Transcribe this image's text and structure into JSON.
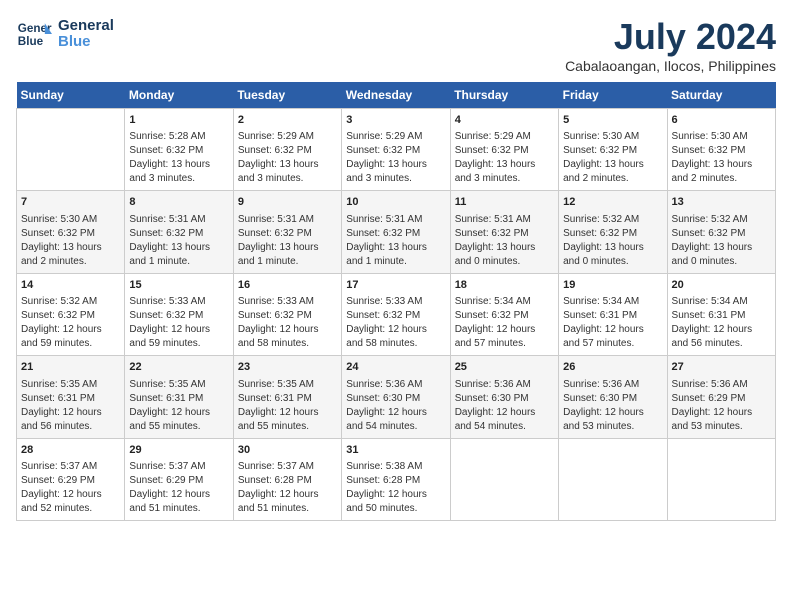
{
  "logo": {
    "line1": "General",
    "line2": "Blue"
  },
  "title": "July 2024",
  "subtitle": "Cabalaoangan, Ilocos, Philippines",
  "headers": [
    "Sunday",
    "Monday",
    "Tuesday",
    "Wednesday",
    "Thursday",
    "Friday",
    "Saturday"
  ],
  "weeks": [
    [
      {
        "day": "",
        "info": ""
      },
      {
        "day": "1",
        "info": "Sunrise: 5:28 AM\nSunset: 6:32 PM\nDaylight: 13 hours\nand 3 minutes."
      },
      {
        "day": "2",
        "info": "Sunrise: 5:29 AM\nSunset: 6:32 PM\nDaylight: 13 hours\nand 3 minutes."
      },
      {
        "day": "3",
        "info": "Sunrise: 5:29 AM\nSunset: 6:32 PM\nDaylight: 13 hours\nand 3 minutes."
      },
      {
        "day": "4",
        "info": "Sunrise: 5:29 AM\nSunset: 6:32 PM\nDaylight: 13 hours\nand 3 minutes."
      },
      {
        "day": "5",
        "info": "Sunrise: 5:30 AM\nSunset: 6:32 PM\nDaylight: 13 hours\nand 2 minutes."
      },
      {
        "day": "6",
        "info": "Sunrise: 5:30 AM\nSunset: 6:32 PM\nDaylight: 13 hours\nand 2 minutes."
      }
    ],
    [
      {
        "day": "7",
        "info": "Sunrise: 5:30 AM\nSunset: 6:32 PM\nDaylight: 13 hours\nand 2 minutes."
      },
      {
        "day": "8",
        "info": "Sunrise: 5:31 AM\nSunset: 6:32 PM\nDaylight: 13 hours\nand 1 minute."
      },
      {
        "day": "9",
        "info": "Sunrise: 5:31 AM\nSunset: 6:32 PM\nDaylight: 13 hours\nand 1 minute."
      },
      {
        "day": "10",
        "info": "Sunrise: 5:31 AM\nSunset: 6:32 PM\nDaylight: 13 hours\nand 1 minute."
      },
      {
        "day": "11",
        "info": "Sunrise: 5:31 AM\nSunset: 6:32 PM\nDaylight: 13 hours\nand 0 minutes."
      },
      {
        "day": "12",
        "info": "Sunrise: 5:32 AM\nSunset: 6:32 PM\nDaylight: 13 hours\nand 0 minutes."
      },
      {
        "day": "13",
        "info": "Sunrise: 5:32 AM\nSunset: 6:32 PM\nDaylight: 13 hours\nand 0 minutes."
      }
    ],
    [
      {
        "day": "14",
        "info": "Sunrise: 5:32 AM\nSunset: 6:32 PM\nDaylight: 12 hours\nand 59 minutes."
      },
      {
        "day": "15",
        "info": "Sunrise: 5:33 AM\nSunset: 6:32 PM\nDaylight: 12 hours\nand 59 minutes."
      },
      {
        "day": "16",
        "info": "Sunrise: 5:33 AM\nSunset: 6:32 PM\nDaylight: 12 hours\nand 58 minutes."
      },
      {
        "day": "17",
        "info": "Sunrise: 5:33 AM\nSunset: 6:32 PM\nDaylight: 12 hours\nand 58 minutes."
      },
      {
        "day": "18",
        "info": "Sunrise: 5:34 AM\nSunset: 6:32 PM\nDaylight: 12 hours\nand 57 minutes."
      },
      {
        "day": "19",
        "info": "Sunrise: 5:34 AM\nSunset: 6:31 PM\nDaylight: 12 hours\nand 57 minutes."
      },
      {
        "day": "20",
        "info": "Sunrise: 5:34 AM\nSunset: 6:31 PM\nDaylight: 12 hours\nand 56 minutes."
      }
    ],
    [
      {
        "day": "21",
        "info": "Sunrise: 5:35 AM\nSunset: 6:31 PM\nDaylight: 12 hours\nand 56 minutes."
      },
      {
        "day": "22",
        "info": "Sunrise: 5:35 AM\nSunset: 6:31 PM\nDaylight: 12 hours\nand 55 minutes."
      },
      {
        "day": "23",
        "info": "Sunrise: 5:35 AM\nSunset: 6:31 PM\nDaylight: 12 hours\nand 55 minutes."
      },
      {
        "day": "24",
        "info": "Sunrise: 5:36 AM\nSunset: 6:30 PM\nDaylight: 12 hours\nand 54 minutes."
      },
      {
        "day": "25",
        "info": "Sunrise: 5:36 AM\nSunset: 6:30 PM\nDaylight: 12 hours\nand 54 minutes."
      },
      {
        "day": "26",
        "info": "Sunrise: 5:36 AM\nSunset: 6:30 PM\nDaylight: 12 hours\nand 53 minutes."
      },
      {
        "day": "27",
        "info": "Sunrise: 5:36 AM\nSunset: 6:29 PM\nDaylight: 12 hours\nand 53 minutes."
      }
    ],
    [
      {
        "day": "28",
        "info": "Sunrise: 5:37 AM\nSunset: 6:29 PM\nDaylight: 12 hours\nand 52 minutes."
      },
      {
        "day": "29",
        "info": "Sunrise: 5:37 AM\nSunset: 6:29 PM\nDaylight: 12 hours\nand 51 minutes."
      },
      {
        "day": "30",
        "info": "Sunrise: 5:37 AM\nSunset: 6:28 PM\nDaylight: 12 hours\nand 51 minutes."
      },
      {
        "day": "31",
        "info": "Sunrise: 5:38 AM\nSunset: 6:28 PM\nDaylight: 12 hours\nand 50 minutes."
      },
      {
        "day": "",
        "info": ""
      },
      {
        "day": "",
        "info": ""
      },
      {
        "day": "",
        "info": ""
      }
    ]
  ]
}
